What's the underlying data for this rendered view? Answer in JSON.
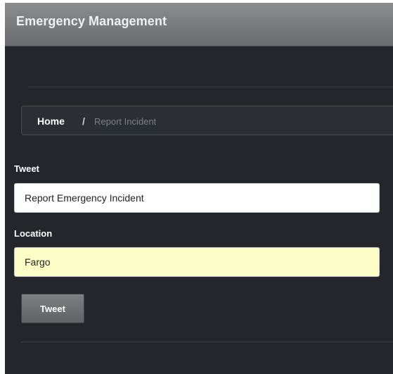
{
  "app": {
    "title": "Emergency Management"
  },
  "breadcrumb": {
    "home": "Home",
    "separator": "/",
    "current": "Report Incident"
  },
  "form": {
    "tweet_label": "Tweet",
    "tweet_value": "Report Emergency Incident",
    "location_label": "Location",
    "location_value": "Fargo",
    "submit_label": "Tweet"
  },
  "colors": {
    "page_background": "#23262b",
    "header_background": "#7a7c7f",
    "location_field_background": "#fdfdc6",
    "button_background": "#6e7174"
  }
}
